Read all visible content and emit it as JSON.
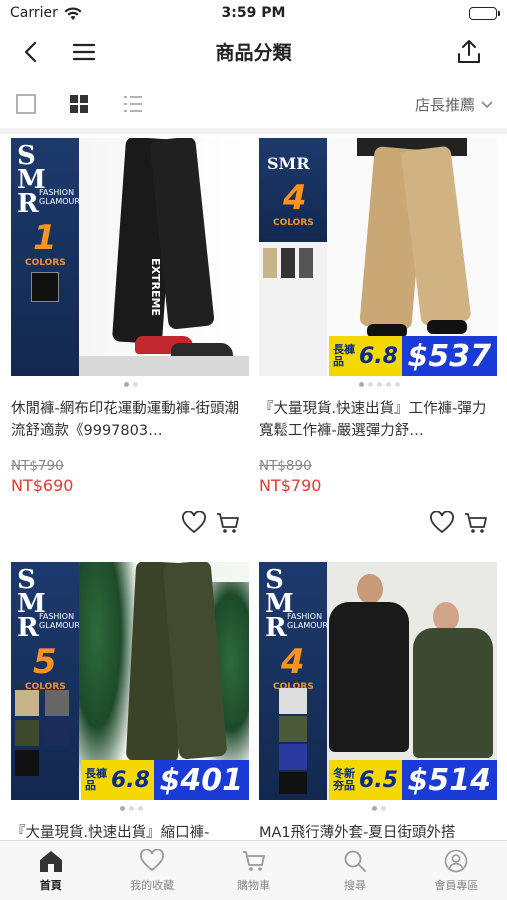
{
  "status_bar": {
    "carrier": "Carrier",
    "time": "3:59 PM"
  },
  "nav": {
    "title": "商品分類"
  },
  "toolbar": {
    "sort_label": "店長推薦"
  },
  "products": [
    {
      "name": "休閒褲-網布印花運動運動褲-街頭潮流舒適款《9997803…",
      "old_price": "NT$790",
      "price": "NT$690",
      "brand_count": "1",
      "brand_colors": "COLORS",
      "print_text": "EXTREME"
    },
    {
      "name": "『大量現貨.快速出貨』工作褲-彈力寬鬆工作褲-嚴選彈力舒…",
      "old_price": "NT$890",
      "price": "NT$790",
      "brand_count": "4",
      "brand_colors": "COLORS",
      "badge_label_1": "長褲",
      "badge_label_2": "品",
      "badge_discount": "6.8",
      "badge_amount": "$537"
    },
    {
      "name": "『大量現貨.快速出貨』縮口褲-",
      "old_price": "",
      "price": "",
      "brand_count": "5",
      "brand_colors": "COLORS",
      "badge_label_1": "長褲",
      "badge_label_2": "品",
      "badge_discount": "6.8",
      "badge_amount": "$401"
    },
    {
      "name": "MA1飛行薄外套-夏日街頭外搭",
      "old_price": "",
      "price": "",
      "brand_count": "4",
      "brand_colors": "COLORS",
      "badge_label_1": "冬新",
      "badge_label_2": "夯品",
      "badge_discount": "6.5",
      "badge_amount": "$514"
    }
  ],
  "brand": {
    "logo": "SMR",
    "sub1": "FASHION",
    "sub2": "GLAMOUR"
  },
  "tabs": [
    {
      "label": "首頁",
      "icon": "home-icon",
      "active": true
    },
    {
      "label": "我的收藏",
      "icon": "heart-icon"
    },
    {
      "label": "購物車",
      "icon": "cart-icon"
    },
    {
      "label": "搜尋",
      "icon": "search-icon"
    },
    {
      "label": "會員專區",
      "icon": "user-icon"
    }
  ],
  "colors": {
    "sale_price": "#e53935",
    "brand_blue": "#1d3a6e",
    "badge_yellow": "#f4d800"
  }
}
